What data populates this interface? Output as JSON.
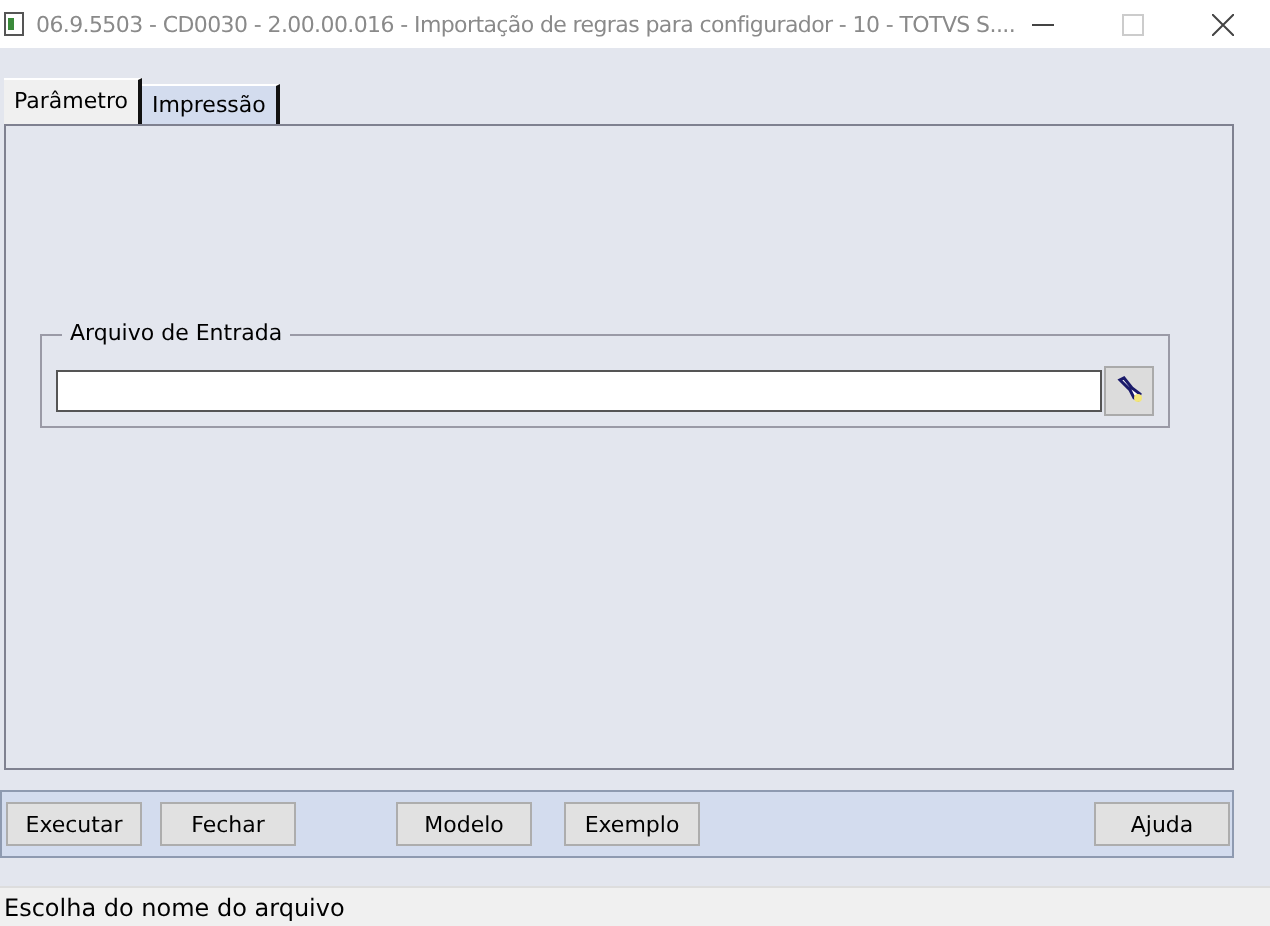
{
  "window": {
    "title": "06.9.5503 - CD0030 - 2.00.00.016 - Importação de regras para configurador - 10 - TOTVS S...."
  },
  "tabs": [
    {
      "label": "Parâmetro",
      "selected": true
    },
    {
      "label": "Impressão",
      "selected": false
    }
  ],
  "input_group": {
    "legend": "Arquivo de Entrada"
  },
  "button_bar": {
    "left_buttons": [
      "Executar",
      "Fechar"
    ],
    "middle_buttons": [
      "Modelo",
      "Exemplo"
    ],
    "right_buttons": [
      "Ajuda"
    ]
  },
  "status_bar": {
    "text": "Escolha do nome do arquivo"
  }
}
